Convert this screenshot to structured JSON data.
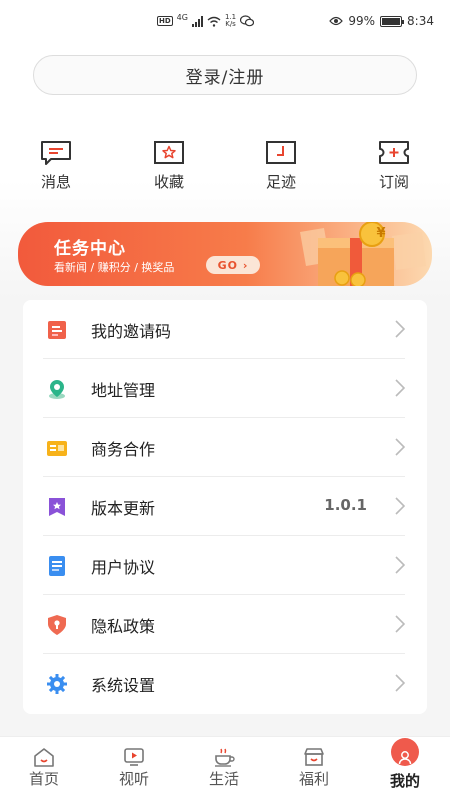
{
  "status_bar": {
    "hd": "HD",
    "network": "4G",
    "speed_value": "1.1",
    "speed_unit": "K/s",
    "battery": "99%",
    "battery_level": 0.99,
    "time": "8:34"
  },
  "login": {
    "label": "登录/注册"
  },
  "quick_actions": [
    {
      "label": "消息",
      "icon": "message-icon"
    },
    {
      "label": "收藏",
      "icon": "star-icon"
    },
    {
      "label": "足迹",
      "icon": "footprint-icon"
    },
    {
      "label": "订阅",
      "icon": "ticket-icon"
    }
  ],
  "banner": {
    "title": "任务中心",
    "subtitle": "看新闻 / 赚积分 / 换奖品",
    "go_label": "GO",
    "coin_symbol": "¥"
  },
  "menu": [
    {
      "label": "我的邀请码",
      "icon": "invite-code-icon",
      "value": ""
    },
    {
      "label": "地址管理",
      "icon": "location-icon",
      "value": ""
    },
    {
      "label": "商务合作",
      "icon": "business-card-icon",
      "value": ""
    },
    {
      "label": "版本更新",
      "icon": "version-icon",
      "value": "1.0.1"
    },
    {
      "label": "用户协议",
      "icon": "document-icon",
      "value": ""
    },
    {
      "label": "隐私政策",
      "icon": "shield-icon",
      "value": ""
    },
    {
      "label": "系统设置",
      "icon": "gear-icon",
      "value": ""
    }
  ],
  "bottom_nav": [
    {
      "label": "首页",
      "icon": "home-icon",
      "active": false
    },
    {
      "label": "视听",
      "icon": "video-icon",
      "active": false
    },
    {
      "label": "生活",
      "icon": "coffee-icon",
      "active": false
    },
    {
      "label": "福利",
      "icon": "store-icon",
      "active": false
    },
    {
      "label": "我的",
      "icon": "profile-icon",
      "active": true
    }
  ],
  "colors": {
    "accent": "#ef5a4c",
    "banner_start": "#f25a3c",
    "banner_end": "#fcd9b0"
  }
}
